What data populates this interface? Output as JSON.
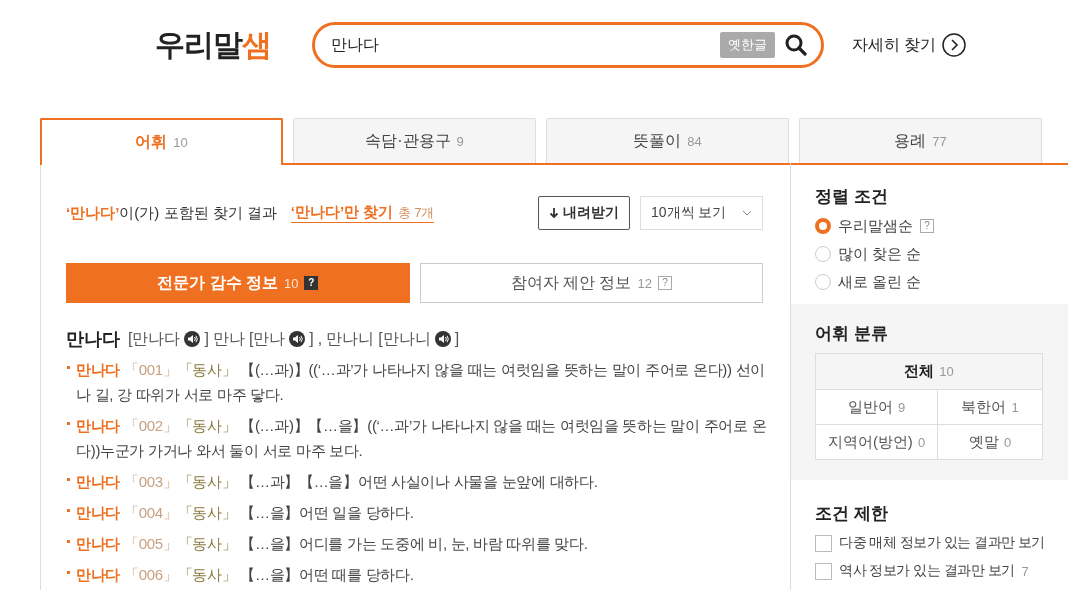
{
  "logo": {
    "text": "우리말",
    "accent": "샘"
  },
  "search": {
    "value": "만나다",
    "old_hangul_button": "옛한글"
  },
  "advanced_search": "자세히 찾기",
  "tabs": [
    {
      "label": "어휘",
      "count": "10",
      "selected": true
    },
    {
      "label": "속담·관용구",
      "count": "9",
      "selected": false
    },
    {
      "label": "뜻풀이",
      "count": "84",
      "selected": false
    },
    {
      "label": "용례",
      "count": "77",
      "selected": false
    }
  ],
  "summary": {
    "query": "‘만나다’",
    "text": "이(가) 포함된 찾기 결과",
    "exact_link": "‘만나다’만 찾기",
    "exact_count": "총 7개"
  },
  "download_button": "내려받기",
  "page_size_select": "10개씩 보기",
  "sub_tabs": [
    {
      "label": "전문가 감수 정보",
      "count": "10",
      "help": "?",
      "selected": true
    },
    {
      "label": "참여자 제안 정보",
      "count": "12",
      "help": "?",
      "selected": false
    }
  ],
  "headword": {
    "word": "만나다",
    "pron": "[만나다",
    "close": "]",
    "inflections": [
      {
        "word": "만나",
        "pron": "[만나",
        "close": "]"
      },
      {
        "word": "만나니",
        "pron": "[만나니",
        "close": "]"
      }
    ],
    "separator": ","
  },
  "senses": [
    {
      "word": "만나다",
      "number": "「001」",
      "pos": "「동사」",
      "definition": "【(…과)】((‘…과’가 나타나지 않을 때는 여럿임을 뜻하는 말이 주어로 온다)) 선이나 길, 강 따위가 서로 마주 닿다."
    },
    {
      "word": "만나다",
      "number": "「002」",
      "pos": "「동사」",
      "definition": "【(…과)】【…을】((‘…과’가 나타나지 않을 때는 여럿임을 뜻하는 말이 주어로 온다))누군가 가거나 와서 둘이 서로 마주 보다."
    },
    {
      "word": "만나다",
      "number": "「003」",
      "pos": "「동사」",
      "definition": "【…과】【…을】어떤 사실이나 사물을 눈앞에 대하다."
    },
    {
      "word": "만나다",
      "number": "「004」",
      "pos": "「동사」",
      "definition": "【…을】어떤 일을 당하다."
    },
    {
      "word": "만나다",
      "number": "「005」",
      "pos": "「동사」",
      "definition": "【…을】어디를 가는 도중에 비, 눈, 바람 따위를 맞다."
    },
    {
      "word": "만나다",
      "number": "「006」",
      "pos": "「동사」",
      "definition": "【…을】어떤 때를 당하다."
    }
  ],
  "sort": {
    "title": "정렬 조건",
    "options": [
      {
        "label": "우리말샘순",
        "help": "?",
        "selected": true
      },
      {
        "label": "많이 찾은 순",
        "selected": false
      },
      {
        "label": "새로 올린 순",
        "selected": false
      }
    ]
  },
  "categories": {
    "title": "어휘 분류",
    "items": [
      {
        "label": "전체",
        "count": "10",
        "selected": true
      },
      {
        "label": "일반어",
        "count": "9",
        "selected": false
      },
      {
        "label": "북한어",
        "count": "1",
        "selected": false
      },
      {
        "label": "지역어(방언)",
        "count": "0",
        "selected": false
      },
      {
        "label": "옛말",
        "count": "0",
        "selected": false
      }
    ]
  },
  "filters": {
    "title": "조건 제한",
    "options": [
      {
        "label": "다중 매체 정보가 있는 결과만 보기",
        "checked": false
      },
      {
        "label": "역사 정보가 있는 결과만 보기",
        "count": "7",
        "checked": false
      }
    ]
  }
}
